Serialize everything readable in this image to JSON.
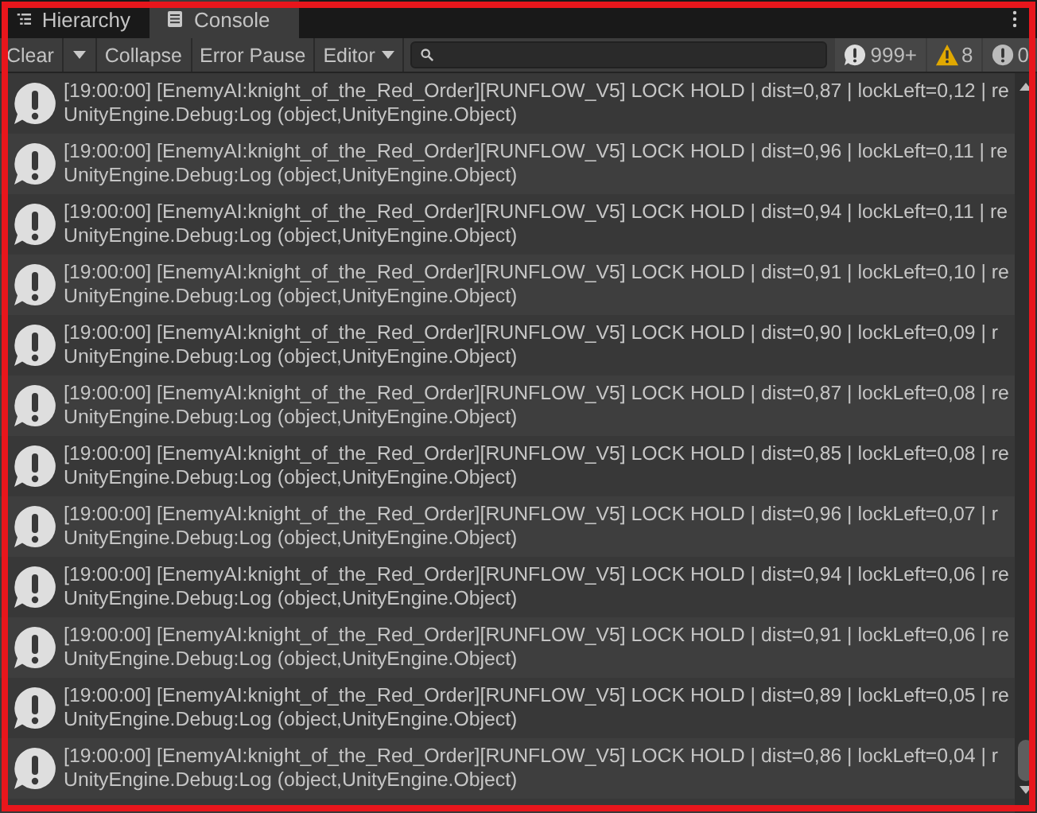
{
  "tabs": [
    {
      "label": "Hierarchy",
      "kind": "hierarchy",
      "selected": false
    },
    {
      "label": "Console",
      "kind": "console",
      "selected": true
    }
  ],
  "toolbar": {
    "buttons": [
      {
        "label": "Clear",
        "kind": "button"
      },
      {
        "label": "Collapse",
        "kind": "toggle"
      },
      {
        "label": "Error Pause",
        "kind": "toggle"
      },
      {
        "label": "Editor",
        "kind": "dropdown"
      }
    ],
    "counters": [
      {
        "kind": "info",
        "count": "999+"
      },
      {
        "kind": "warning",
        "count": "8"
      },
      {
        "kind": "error",
        "count": "0"
      }
    ]
  },
  "entries": [
    {
      "message": "[19:00:00] [EnemyAI:knight_of_the_Red_Order][RUNFLOW_V5] LOCK HOLD | dist=0,87 | lockLeft=0,12 | re",
      "trace": "UnityEngine.Debug:Log (object,UnityEngine.Object)"
    },
    {
      "message": "[19:00:00] [EnemyAI:knight_of_the_Red_Order][RUNFLOW_V5] LOCK HOLD | dist=0,96 | lockLeft=0,11 | re",
      "trace": "UnityEngine.Debug:Log (object,UnityEngine.Object)"
    },
    {
      "message": "[19:00:00] [EnemyAI:knight_of_the_Red_Order][RUNFLOW_V5] LOCK HOLD | dist=0,94 | lockLeft=0,11 | re",
      "trace": "UnityEngine.Debug:Log (object,UnityEngine.Object)"
    },
    {
      "message": "[19:00:00] [EnemyAI:knight_of_the_Red_Order][RUNFLOW_V5] LOCK HOLD | dist=0,91 | lockLeft=0,10 | re",
      "trace": "UnityEngine.Debug:Log (object,UnityEngine.Object)"
    },
    {
      "message": "[19:00:00] [EnemyAI:knight_of_the_Red_Order][RUNFLOW_V5] LOCK HOLD | dist=0,90 | lockLeft=0,09 | r",
      "trace": "UnityEngine.Debug:Log (object,UnityEngine.Object)"
    },
    {
      "message": "[19:00:00] [EnemyAI:knight_of_the_Red_Order][RUNFLOW_V5] LOCK HOLD | dist=0,87 | lockLeft=0,08 | re",
      "trace": "UnityEngine.Debug:Log (object,UnityEngine.Object)"
    },
    {
      "message": "[19:00:00] [EnemyAI:knight_of_the_Red_Order][RUNFLOW_V5] LOCK HOLD | dist=0,85 | lockLeft=0,08 | re",
      "trace": "UnityEngine.Debug:Log (object,UnityEngine.Object)"
    },
    {
      "message": "[19:00:00] [EnemyAI:knight_of_the_Red_Order][RUNFLOW_V5] LOCK HOLD | dist=0,96 | lockLeft=0,07 | r",
      "trace": "UnityEngine.Debug:Log (object,UnityEngine.Object)"
    },
    {
      "message": "[19:00:00] [EnemyAI:knight_of_the_Red_Order][RUNFLOW_V5] LOCK HOLD | dist=0,94 | lockLeft=0,06 | re",
      "trace": "UnityEngine.Debug:Log (object,UnityEngine.Object)"
    },
    {
      "message": "[19:00:00] [EnemyAI:knight_of_the_Red_Order][RUNFLOW_V5] LOCK HOLD | dist=0,91 | lockLeft=0,06 | re",
      "trace": "UnityEngine.Debug:Log (object,UnityEngine.Object)"
    },
    {
      "message": "[19:00:00] [EnemyAI:knight_of_the_Red_Order][RUNFLOW_V5] LOCK HOLD | dist=0,89 | lockLeft=0,05 | re",
      "trace": "UnityEngine.Debug:Log (object,UnityEngine.Object)"
    },
    {
      "message": "[19:00:00] [EnemyAI:knight_of_the_Red_Order][RUNFLOW_V5] LOCK HOLD | dist=0,86 | lockLeft=0,04 | r",
      "trace": "UnityEngine.Debug:Log (object,UnityEngine.Object)"
    }
  ]
}
